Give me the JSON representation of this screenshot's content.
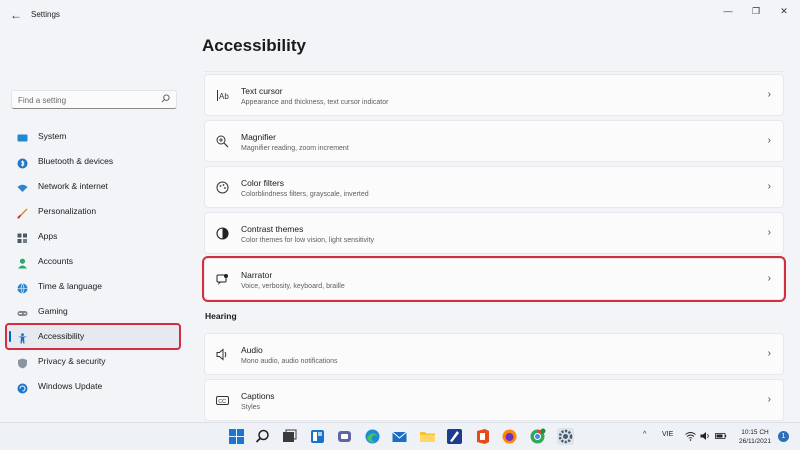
{
  "window": {
    "app_title": "Settings",
    "back_glyph": "←",
    "minimize_glyph": "—",
    "maximize_glyph": "❐",
    "close_glyph": "✕"
  },
  "search": {
    "placeholder": "Find a setting"
  },
  "sidebar": {
    "items": [
      {
        "label": "System",
        "icon": "monitor-icon"
      },
      {
        "label": "Bluetooth & devices",
        "icon": "bluetooth-icon"
      },
      {
        "label": "Network & internet",
        "icon": "wifi-icon"
      },
      {
        "label": "Personalization",
        "icon": "brush-icon"
      },
      {
        "label": "Apps",
        "icon": "apps-icon"
      },
      {
        "label": "Accounts",
        "icon": "person-icon"
      },
      {
        "label": "Time & language",
        "icon": "globe-icon"
      },
      {
        "label": "Gaming",
        "icon": "gamepad-icon"
      },
      {
        "label": "Accessibility",
        "icon": "accessibility-icon",
        "active": true
      },
      {
        "label": "Privacy & security",
        "icon": "shield-icon"
      },
      {
        "label": "Windows Update",
        "icon": "update-icon"
      }
    ]
  },
  "main": {
    "title": "Accessibility",
    "cards": [
      {
        "title": "Text cursor",
        "subtitle": "Appearance and thickness, text cursor indicator",
        "icon": "text-cursor-icon"
      },
      {
        "title": "Magnifier",
        "subtitle": "Magnifier reading, zoom increment",
        "icon": "magnifier-icon"
      },
      {
        "title": "Color filters",
        "subtitle": "Colorblindness filters, grayscale, inverted",
        "icon": "color-filters-icon"
      },
      {
        "title": "Contrast themes",
        "subtitle": "Color themes for low vision, light sensitivity",
        "icon": "contrast-icon"
      },
      {
        "title": "Narrator",
        "subtitle": "Voice, verbosity, keyboard, braille",
        "icon": "narrator-icon"
      }
    ],
    "section_hearing": "Hearing",
    "hearing_cards": [
      {
        "title": "Audio",
        "subtitle": "Mono audio, audio notifications",
        "icon": "speaker-icon"
      },
      {
        "title": "Captions",
        "subtitle": "Styles",
        "icon": "captions-icon"
      }
    ],
    "chevron": "›"
  },
  "taskbar": {
    "language": "VIE",
    "time": "10:15 CH",
    "date": "26/11/2021",
    "notification_count": "1",
    "tray_chevron": "^"
  },
  "colors": {
    "highlight_box": "#d42d3f",
    "accent": "#0067c0"
  }
}
